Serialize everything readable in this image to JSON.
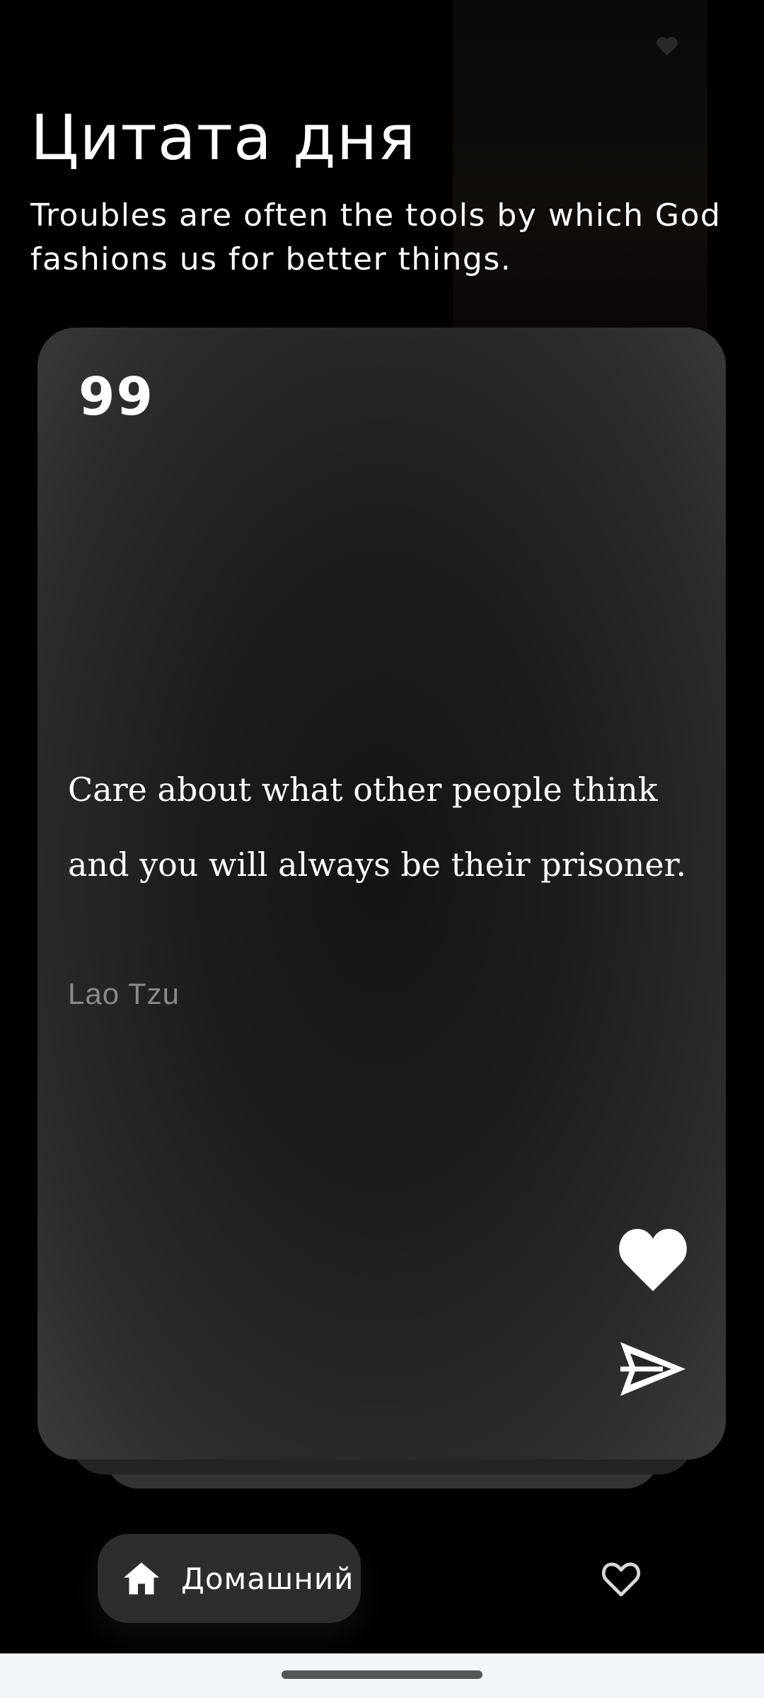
{
  "header": {
    "title": "Цитата дня",
    "subtitle": "Troubles are often the tools by which God fashions us for better things."
  },
  "card": {
    "quote_mark": "99",
    "quote": "Care about what other people think and you will always be their prisoner.",
    "author": "Lao Tzu",
    "actions": {
      "like_icon": "heart-filled-icon",
      "share_icon": "send-icon"
    }
  },
  "bottom_nav": {
    "home_label": "Домашний",
    "home_icon": "home-icon",
    "favorites_icon": "heart-outline-icon"
  },
  "colors": {
    "background": "#000000",
    "card": "#262626",
    "author_text": "#8a8a8a",
    "nav_pill": "#2d2d2d",
    "gesture_bar": "#f1f6fb"
  }
}
